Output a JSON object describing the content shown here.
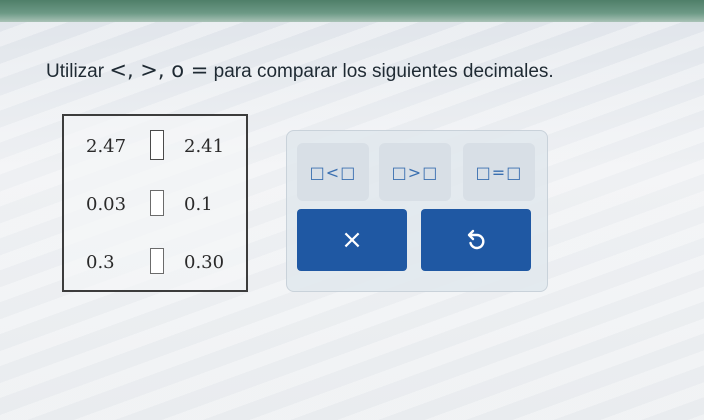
{
  "instruction": {
    "prefix": "Utilizar ",
    "symbols": "<, >, o =",
    "suffix": " para comparar los siguientes decimales."
  },
  "comparisons": [
    {
      "left": "2.47",
      "right": "2.41"
    },
    {
      "left": "0.03",
      "right": "0.1"
    },
    {
      "left": "0.3",
      "right": "0.30"
    }
  ],
  "toolbar": {
    "less_than_label": "□<□",
    "greater_than_label": "□>□",
    "equal_label": "□=□",
    "clear_label": "×",
    "undo_icon": "undo-icon"
  },
  "colors": {
    "accent_blue": "#1f58a3",
    "symbol_blue": "#3a6fb0"
  }
}
